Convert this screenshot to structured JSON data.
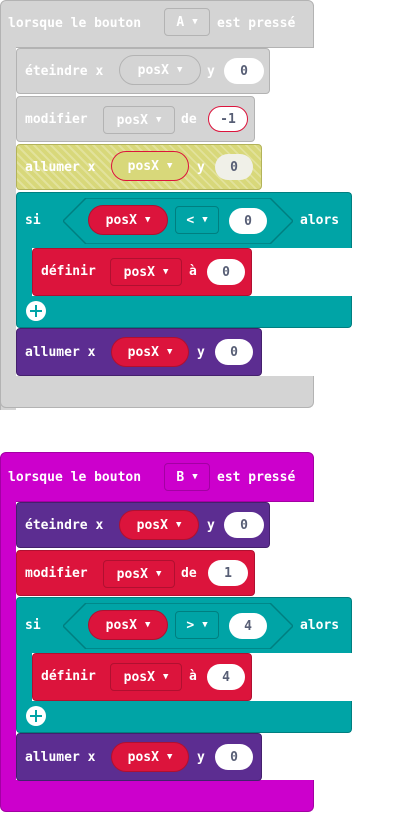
{
  "colors": {
    "disabled_fill": "#d4d4d4",
    "disabled_border": "#b3b3b3",
    "disabled_text": "#ffffff",
    "event_magenta": "#cc00cc",
    "led_purple": "#5c2d91",
    "variable_red": "#dc143c",
    "logic_teal": "#00a4a6",
    "logic_teal_dark": "#007f80",
    "highlight_yellow": "#d8d87a",
    "number_text": "#575e75"
  },
  "scriptA": {
    "event": {
      "prefix": "lorsque le bouton",
      "button": "A",
      "suffix": "est pressé"
    },
    "unplot": {
      "label": "éteindre x",
      "x_var": "posX",
      "y_label": "y",
      "y_value": "0"
    },
    "change": {
      "label": "modifier",
      "var": "posX",
      "by_label": "de",
      "value": "-1"
    },
    "plot": {
      "label": "allumer x",
      "x_var": "posX",
      "y_label": "y",
      "y_value": "0"
    },
    "if": {
      "if_label": "si",
      "var": "posX",
      "operator": "<",
      "value": "0",
      "then_label": "alors",
      "set": {
        "label": "définir",
        "var": "posX",
        "to_label": "à",
        "value": "0"
      },
      "add_icon": "plus-circle-icon"
    },
    "plot2": {
      "label": "allumer x",
      "x_var": "posX",
      "y_label": "y",
      "y_value": "0"
    }
  },
  "scriptB": {
    "event": {
      "prefix": "lorsque le bouton",
      "button": "B",
      "suffix": "est pressé"
    },
    "unplot": {
      "label": "éteindre x",
      "x_var": "posX",
      "y_label": "y",
      "y_value": "0"
    },
    "change": {
      "label": "modifier",
      "var": "posX",
      "by_label": "de",
      "value": "1"
    },
    "if": {
      "if_label": "si",
      "var": "posX",
      "operator": ">",
      "value": "4",
      "then_label": "alors",
      "set": {
        "label": "définir",
        "var": "posX",
        "to_label": "à",
        "value": "4"
      },
      "add_icon": "plus-circle-icon"
    },
    "plot": {
      "label": "allumer x",
      "x_var": "posX",
      "y_label": "y",
      "y_value": "0"
    }
  }
}
